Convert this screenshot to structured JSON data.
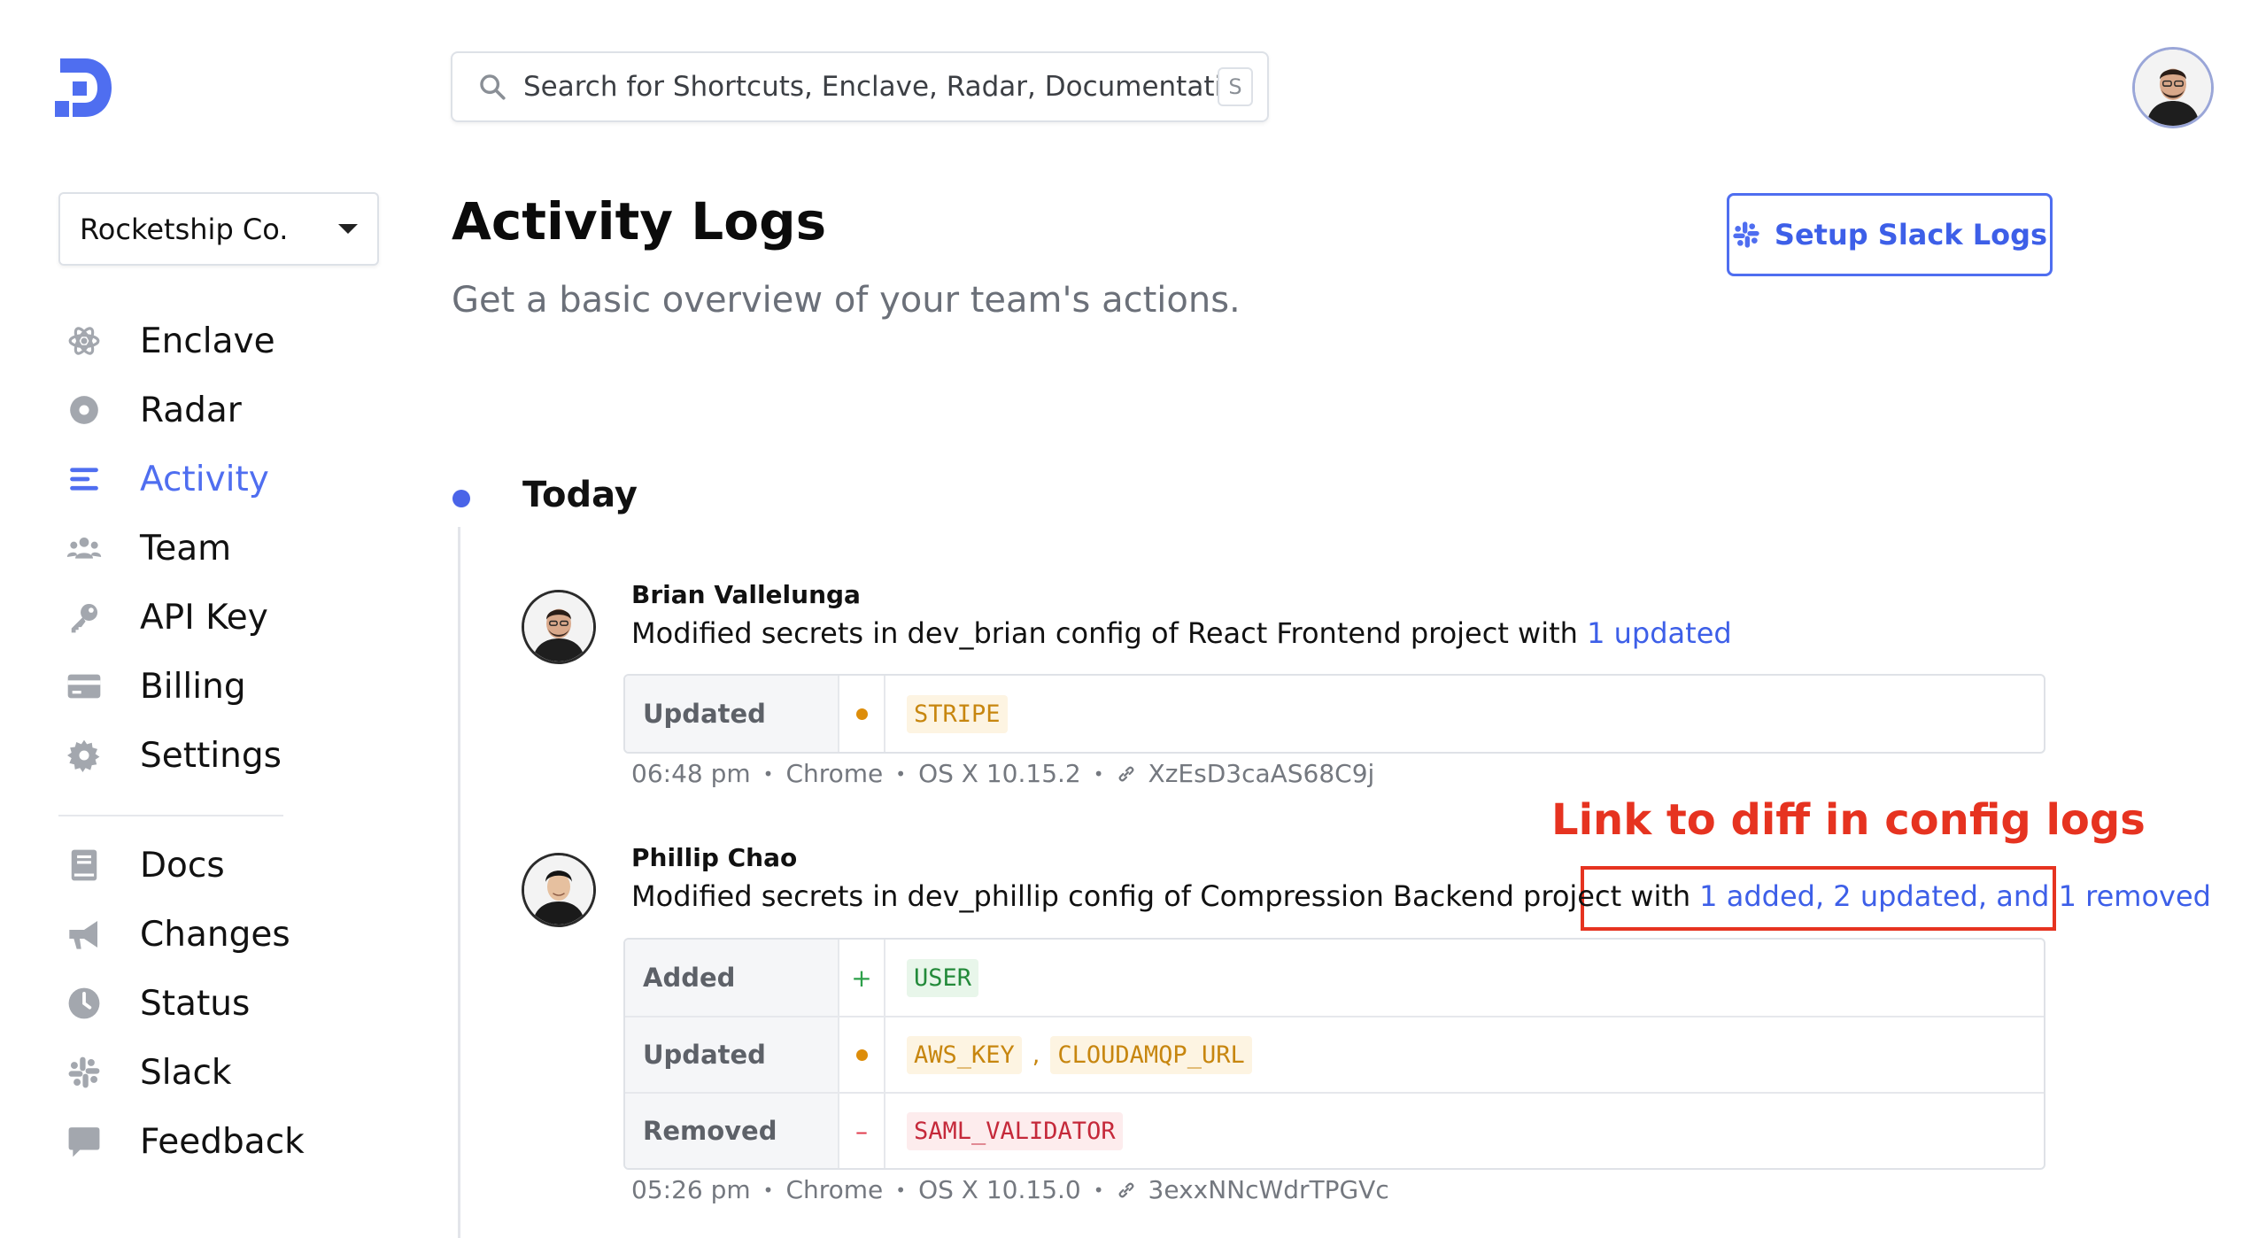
{
  "search": {
    "placeholder": "Search for Shortcuts, Enclave, Radar, Documentation...",
    "shortcut": "S"
  },
  "org": {
    "name": "Rocketship Co."
  },
  "nav": {
    "primary": [
      {
        "label": "Enclave",
        "icon": "atom-icon",
        "active": false
      },
      {
        "label": "Radar",
        "icon": "radar-icon",
        "active": false
      },
      {
        "label": "Activity",
        "icon": "list-icon",
        "active": true
      },
      {
        "label": "Team",
        "icon": "team-icon",
        "active": false
      },
      {
        "label": "API Key",
        "icon": "key-icon",
        "active": false
      },
      {
        "label": "Billing",
        "icon": "credit-card-icon",
        "active": false
      },
      {
        "label": "Settings",
        "icon": "gear-icon",
        "active": false
      }
    ],
    "secondary": [
      {
        "label": "Docs",
        "icon": "book-icon"
      },
      {
        "label": "Changes",
        "icon": "megaphone-icon"
      },
      {
        "label": "Status",
        "icon": "clock-icon"
      },
      {
        "label": "Slack",
        "icon": "slack-icon"
      },
      {
        "label": "Feedback",
        "icon": "chat-bubble-icon"
      }
    ]
  },
  "page": {
    "title": "Activity Logs",
    "subtitle": "Get a basic overview of your team's actions.",
    "slack_button": "Setup Slack Logs"
  },
  "timeline": {
    "day": "Today",
    "entries": [
      {
        "name": "Brian Vallelunga",
        "desc_prefix": "Modified secrets in dev_brian config of React Frontend project with ",
        "desc_link": "1 updated",
        "diff": [
          {
            "label": "Updated",
            "kind": "updated",
            "values": [
              "STRIPE"
            ]
          }
        ],
        "time": "06:48 pm",
        "browser": "Chrome",
        "os": "OS X 10.15.2",
        "id": "XzEsD3caAS68C9j"
      },
      {
        "name": "Phillip Chao",
        "desc_prefix": "Modified secrets in dev_phillip config of Compression Backend project with",
        "desc_link": "1 added, 2 updated, and 1 removed",
        "diff": [
          {
            "label": "Added",
            "kind": "added",
            "marker": "+",
            "values": [
              "USER"
            ]
          },
          {
            "label": "Updated",
            "kind": "updated",
            "values": [
              "AWS_KEY",
              "CLOUDAMQP_URL"
            ]
          },
          {
            "label": "Removed",
            "kind": "removed",
            "marker": "–",
            "values": [
              "SAML_VALIDATOR"
            ]
          }
        ],
        "time": "05:26 pm",
        "browser": "Chrome",
        "os": "OS X 10.15.0",
        "id": "3exxNNcWdrTPGVc"
      }
    ]
  },
  "annotation": {
    "text": "Link to diff in config logs"
  },
  "colors": {
    "accent": "#4f6ef0",
    "annotation": "#e63320",
    "updated": "#dd8d0a",
    "added": "#2da04a",
    "removed": "#e0394a"
  }
}
